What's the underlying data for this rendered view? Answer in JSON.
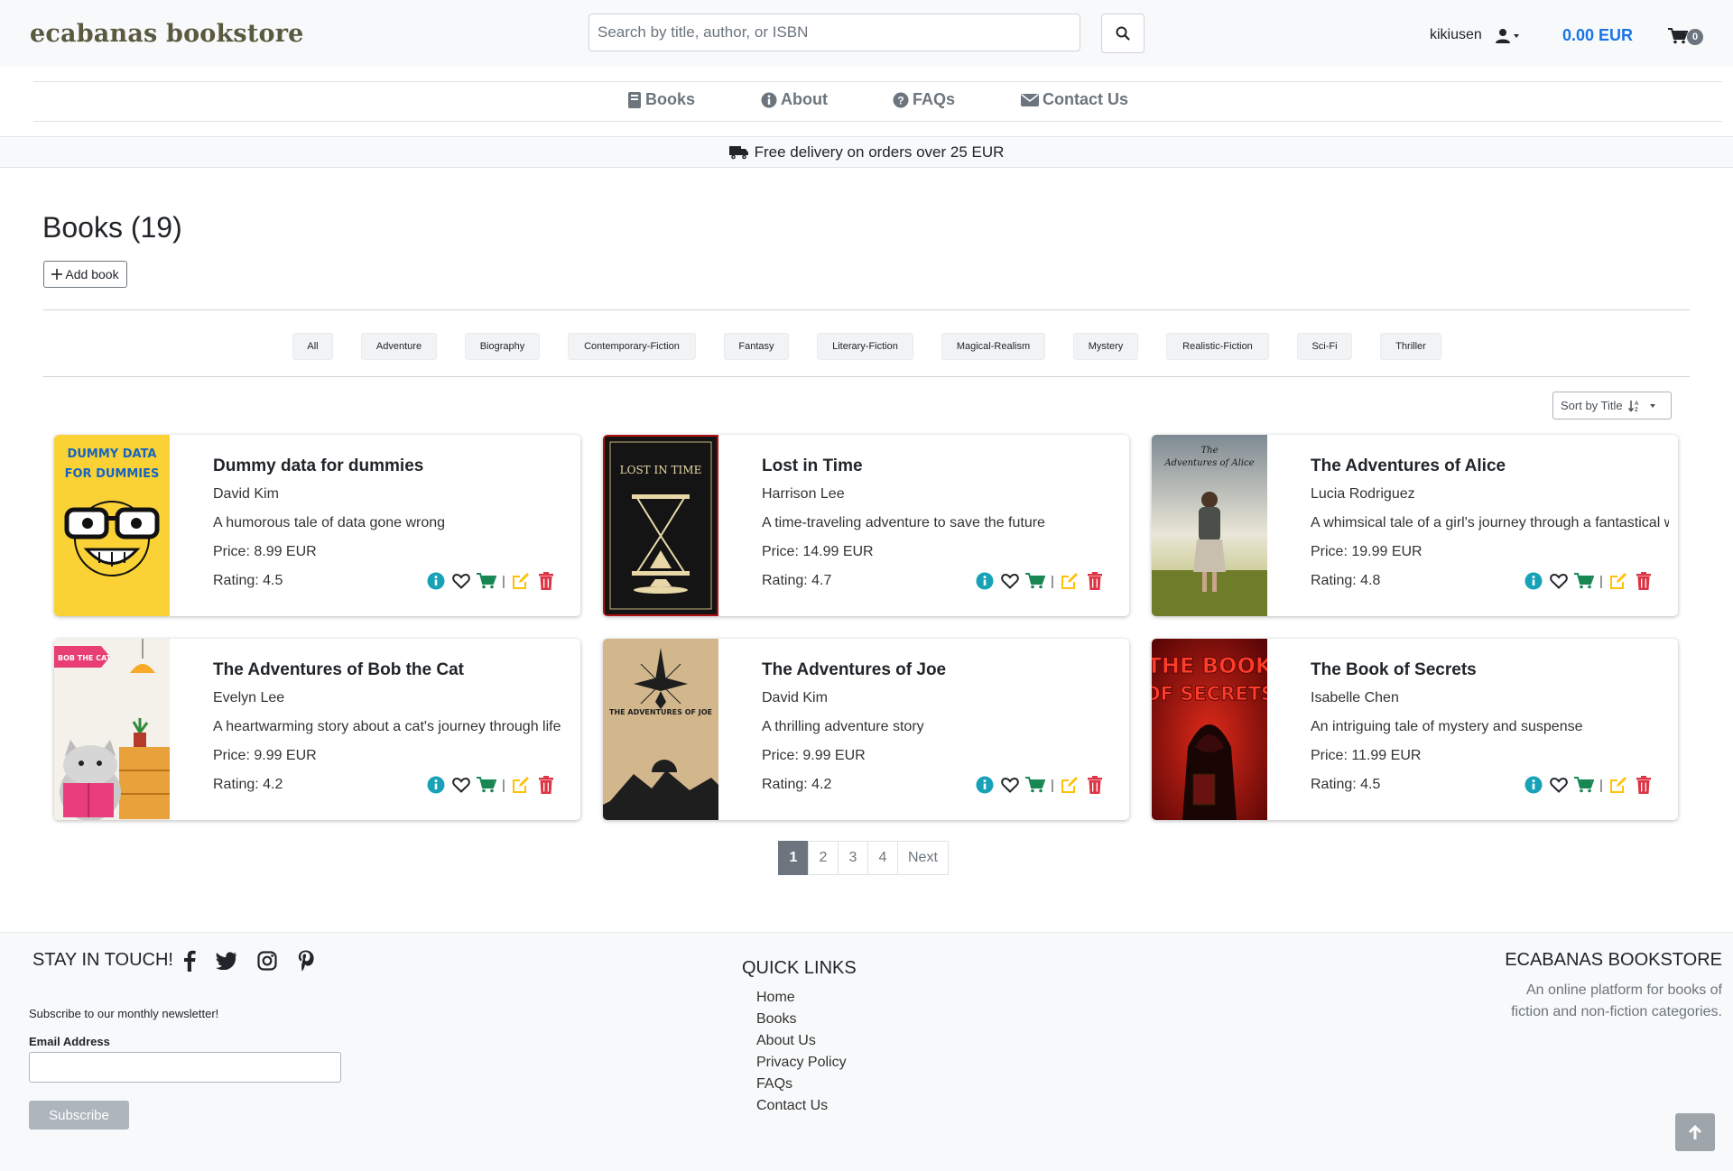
{
  "header": {
    "brand": "ecabanas bookstore",
    "search_placeholder": "Search by title, author, or ISBN",
    "username": "kikiusen",
    "cart_total": "0.00 EUR",
    "cart_count": "0"
  },
  "nav": {
    "items": [
      {
        "label": "Books",
        "icon": "book-icon"
      },
      {
        "label": "About",
        "icon": "info-icon"
      },
      {
        "label": "FAQs",
        "icon": "question-icon"
      },
      {
        "label": "Contact Us",
        "icon": "envelope-icon"
      }
    ]
  },
  "promo": {
    "text": "Free delivery on orders over 25 EUR",
    "icon": "truck-icon"
  },
  "page": {
    "title": "Books (19)",
    "add_book_label": "Add book"
  },
  "filters": [
    "All",
    "Adventure",
    "Biography",
    "Contemporary-Fiction",
    "Fantasy",
    "Literary-Fiction",
    "Magical-Realism",
    "Mystery",
    "Realistic-Fiction",
    "Sci-Fi",
    "Thriller"
  ],
  "sort": {
    "label": "Sort by Title"
  },
  "books": [
    {
      "title": "Dummy data for dummies",
      "author": "David Kim",
      "description": "A humorous tale of data gone wrong",
      "price": "Price: 8.99 EUR",
      "rating": "Rating: 4.5",
      "cover_text": [
        "DUMMY DATA",
        "FOR DUMMIES"
      ]
    },
    {
      "title": "Lost in Time",
      "author": "Harrison Lee",
      "description": "A time-traveling adventure to save the future",
      "price": "Price: 14.99 EUR",
      "rating": "Rating: 4.7",
      "cover_text": [
        "LOST IN TIME"
      ]
    },
    {
      "title": "The Adventures of Alice",
      "author": "Lucia Rodriguez",
      "description": "A whimsical tale of a girl's journey through a fantastical world",
      "price": "Price: 19.99 EUR",
      "rating": "Rating: 4.8",
      "cover_text": [
        "The",
        "Adventures of Alice"
      ]
    },
    {
      "title": "The Adventures of Bob the Cat",
      "author": "Evelyn Lee",
      "description": "A heartwarming story about a cat's journey through life",
      "price": "Price: 9.99 EUR",
      "rating": "Rating: 4.2",
      "cover_text": [
        "BOB THE CAT"
      ]
    },
    {
      "title": "The Adventures of Joe",
      "author": "David Kim",
      "description": "A thrilling adventure story",
      "price": "Price: 9.99 EUR",
      "rating": "Rating: 4.2",
      "cover_text": [
        "THE ADVENTURES OF JOE"
      ]
    },
    {
      "title": "The Book of Secrets",
      "author": "Isabelle Chen",
      "description": "An intriguing tale of mystery and suspense",
      "price": "Price: 11.99 EUR",
      "rating": "Rating: 4.5",
      "cover_text": [
        "THE BOOK",
        "OF SECRETS"
      ]
    }
  ],
  "pagination": {
    "pages": [
      "1",
      "2",
      "3",
      "4"
    ],
    "next_label": "Next",
    "active": "1"
  },
  "footer": {
    "stay_title": "STAY IN TOUCH!",
    "newsletter_text": "Subscribe to our monthly newsletter!",
    "email_label": "Email Address",
    "subscribe_label": "Subscribe",
    "quick_links_title": "QUICK LINKS",
    "quick_links": [
      "Home",
      "Books",
      "About Us",
      "Privacy Policy",
      "FAQs",
      "Contact Us"
    ],
    "store_title": "ECABANAS BOOKSTORE",
    "store_description": "An online platform for books of fiction and non-fiction categories."
  },
  "colors": {
    "info": "#17a2b8",
    "cart": "#198754",
    "edit": "#ffc107",
    "delete": "#dc3545",
    "cart_total": "#1a73e8"
  }
}
